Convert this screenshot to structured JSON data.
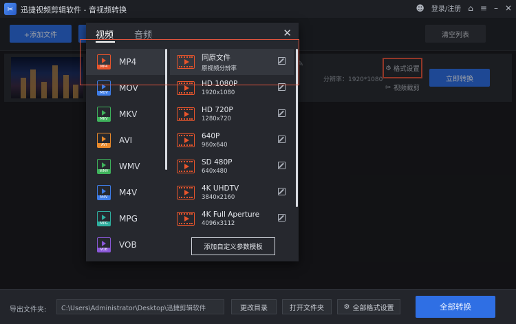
{
  "app": {
    "title": "迅捷视频剪辑软件 - 音视频转换",
    "logo_icon": "scissors-icon"
  },
  "titlebar": {
    "login": "登录/注册",
    "home_icon": "home-icon",
    "menu_icon": "menu-icon",
    "min_icon": "minimize-icon",
    "close_icon": "close-icon"
  },
  "toolbar": {
    "add_file": "+添加文件",
    "clear_list": "清空列表"
  },
  "file": {
    "resolution": "分辨率：1920*1080",
    "format_setting": "格式设置",
    "convert": "立即转换",
    "video_cut": "视频裁剪"
  },
  "dialog": {
    "tabs": [
      "视频",
      "音频"
    ],
    "active_tab": 0,
    "formats": [
      {
        "name": "MP4",
        "color": "#e8552c",
        "selected": true
      },
      {
        "name": "MOV",
        "color": "#3e7de8",
        "selected": false
      },
      {
        "name": "MKV",
        "color": "#3fb35c",
        "selected": false
      },
      {
        "name": "AVI",
        "color": "#e98a2b",
        "selected": false
      },
      {
        "name": "WMV",
        "color": "#3fb35c",
        "selected": false
      },
      {
        "name": "M4V",
        "color": "#3e7de8",
        "selected": false
      },
      {
        "name": "MPG",
        "color": "#2fb0a0",
        "selected": false
      },
      {
        "name": "VOB",
        "color": "#8a58d8",
        "selected": false
      }
    ],
    "presets": [
      {
        "name": "同原文件",
        "sub": "原视频分辨率",
        "selected": true
      },
      {
        "name": "HD 1080P",
        "sub": "1920x1080",
        "selected": false
      },
      {
        "name": "HD 720P",
        "sub": "1280x720",
        "selected": false
      },
      {
        "name": "640P",
        "sub": "960x640",
        "selected": false
      },
      {
        "name": "SD 480P",
        "sub": "640x480",
        "selected": false
      },
      {
        "name": "4K UHDTV",
        "sub": "3840x2160",
        "selected": false
      },
      {
        "name": "4K Full Aperture",
        "sub": "4096x3112",
        "selected": false
      }
    ],
    "custom_template": "添加自定义参数模板"
  },
  "bottom": {
    "export_label": "导出文件夹:",
    "path": "C:\\Users\\Administrator\\Desktop\\迅捷剪辑软件",
    "change_dir": "更改目录",
    "open_folder": "打开文件夹",
    "all_format": "全部格式设置",
    "convert_all": "全部转换"
  },
  "colors": {
    "accent": "#2f6fe4",
    "highlight": "#e2553e",
    "preset_icon": "#e8552c"
  }
}
